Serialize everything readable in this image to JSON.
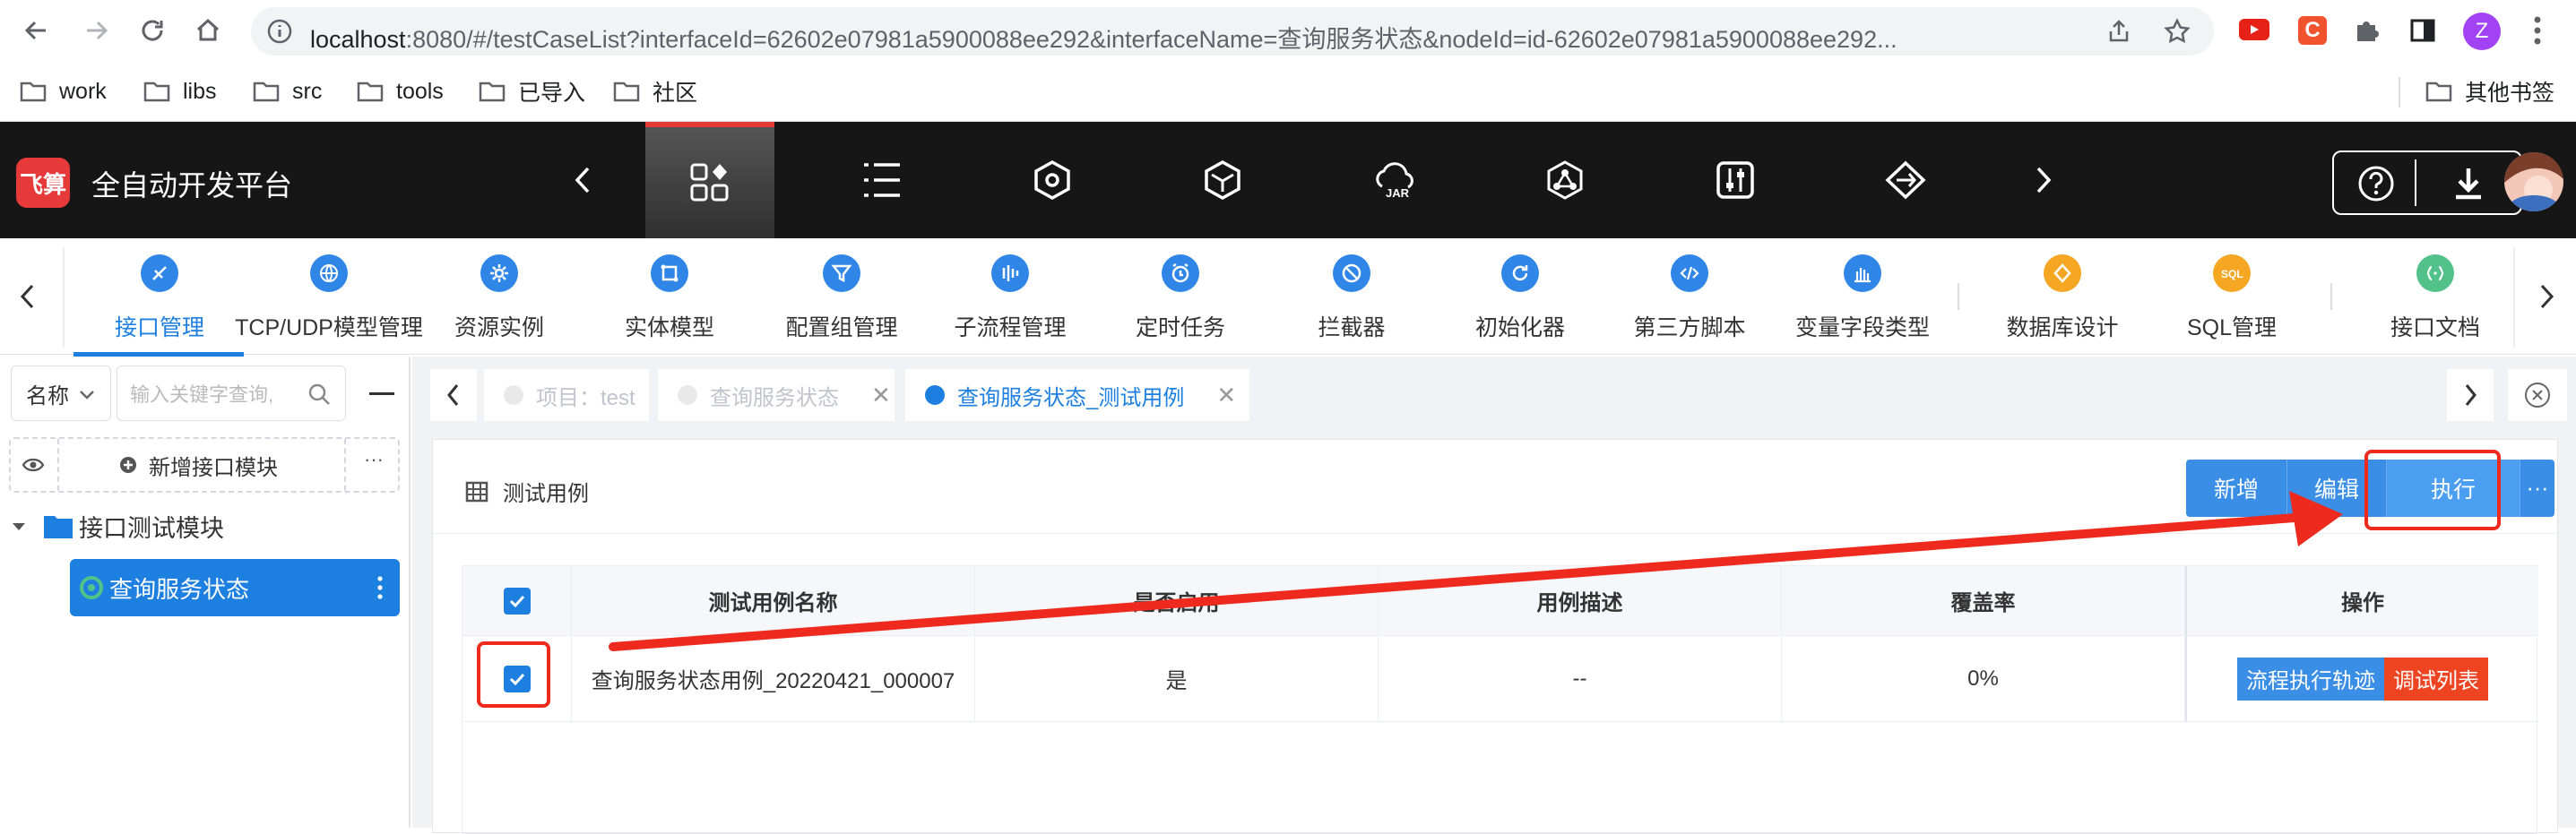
{
  "browser": {
    "url_host": "localhost",
    "url_rest": ":8080/#/testCaseList?interfaceId=62602e07981a5900088ee292&interfaceName=查询服务状态&nodeId=id-62602e07981a5900088ee292...",
    "profile_initial": "Z",
    "bookmarks": [
      "work",
      "libs",
      "src",
      "tools",
      "已导入",
      "社区"
    ],
    "other_bookmarks": "其他书签"
  },
  "app": {
    "logo_text": "飞算",
    "title": "全自动开发平台"
  },
  "modules": [
    {
      "label": "接口管理",
      "icon": "interface-icon",
      "color": "#2f86e6"
    },
    {
      "label": "TCP/UDP模型管理",
      "icon": "globe-icon",
      "color": "#2f86e6"
    },
    {
      "label": "资源实例",
      "icon": "gear-icon",
      "color": "#2f86e6"
    },
    {
      "label": "实体模型",
      "icon": "entity-icon",
      "color": "#2f86e6"
    },
    {
      "label": "配置组管理",
      "icon": "funnel-icon",
      "color": "#2f86e6"
    },
    {
      "label": "子流程管理",
      "icon": "flow-icon",
      "color": "#2f86e6"
    },
    {
      "label": "定时任务",
      "icon": "alarm-icon",
      "color": "#2f86e6"
    },
    {
      "label": "拦截器",
      "icon": "block-icon",
      "color": "#2f86e6"
    },
    {
      "label": "初始化器",
      "icon": "refresh-icon",
      "color": "#2f86e6"
    },
    {
      "label": "第三方脚本",
      "icon": "code-icon",
      "color": "#2f86e6"
    },
    {
      "label": "变量字段类型",
      "icon": "bars-icon",
      "color": "#2f86e6"
    },
    {
      "label": "数据库设计",
      "icon": "database-icon",
      "color": "#f5a623"
    },
    {
      "label": "SQL管理",
      "icon": "sql-icon",
      "color": "#f5a623"
    },
    {
      "label": "接口文档",
      "icon": "doc-icon",
      "color": "#52c18a"
    }
  ],
  "sidebar": {
    "select_label": "名称",
    "search_placeholder": "输入关键字查询,",
    "add_module_label": "新增接口模块",
    "more_label": "···",
    "tree_root": "接口测试模块",
    "tree_item": "查询服务状态"
  },
  "tabs": [
    {
      "label": "项目：test",
      "closable": false
    },
    {
      "label": "查询服务状态",
      "closable": true
    },
    {
      "label": "查询服务状态_测试用例",
      "closable": true
    }
  ],
  "card": {
    "title": "测试用例",
    "buttons": {
      "add": "新增",
      "edit": "编辑",
      "execute": "执行",
      "more": "···"
    }
  },
  "table": {
    "columns": [
      "测试用例名称",
      "是否启用",
      "用例描述",
      "覆盖率",
      "操作"
    ],
    "rows": [
      {
        "name": "查询服务状态用例_20220421_000007",
        "enabled": "是",
        "description": "--",
        "coverage": "0%",
        "actions": [
          "流程执行轨迹",
          "调试列表"
        ]
      }
    ]
  },
  "colors": {
    "primary": "#1d7fe0",
    "button": "#3a8ee6",
    "danger": "#ee4422",
    "annotation": "#ee2a1f",
    "header": "#161616"
  }
}
